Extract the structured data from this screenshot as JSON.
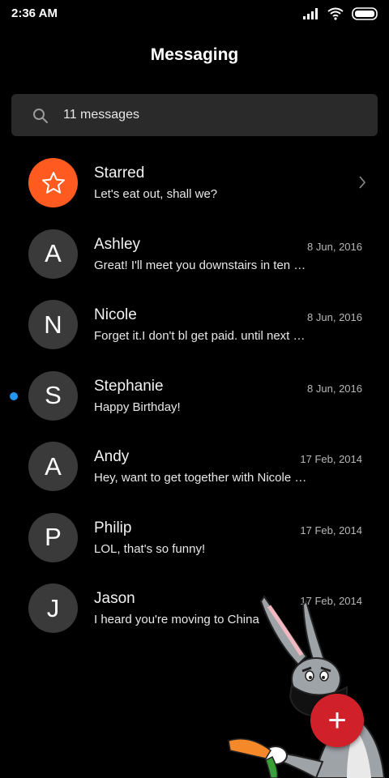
{
  "status_bar": {
    "time": "2:36 AM",
    "icons": [
      "signal-icon",
      "wifi-icon",
      "battery-icon"
    ]
  },
  "header": {
    "title": "Messaging"
  },
  "search": {
    "text": "11 messages"
  },
  "conversations": [
    {
      "name": "Starred",
      "preview": "Let's eat out, shall we?",
      "date": "",
      "avatar": "star-icon",
      "accent": "#ff5a1f"
    },
    {
      "name": "Ashley",
      "preview": "Great! I'll meet you downstairs in ten …",
      "date": "8 Jun, 2016",
      "avatar": "A"
    },
    {
      "name": "Nicole",
      "preview": "Forget it.I don't bl get paid. until next …",
      "date": "8 Jun, 2016",
      "avatar": "N"
    },
    {
      "name": "Stephanie",
      "preview": "Happy Birthday!",
      "date": "8 Jun, 2016",
      "avatar": "S",
      "unread": true
    },
    {
      "name": "Andy",
      "preview": "Hey, want to get together with Nicole …",
      "date": "17 Feb, 2014",
      "avatar": "A"
    },
    {
      "name": "Philip",
      "preview": "LOL, that's so funny!",
      "date": "17 Feb, 2014",
      "avatar": "P"
    },
    {
      "name": "Jason",
      "preview": "I heard you're moving to China",
      "date": "17 Feb, 2014",
      "avatar": "J"
    }
  ],
  "fab": {
    "label": "+"
  },
  "colors": {
    "background": "#000000",
    "accent": "#ff5a1f",
    "fab": "#d0202a",
    "unread_dot": "#2196f3"
  }
}
